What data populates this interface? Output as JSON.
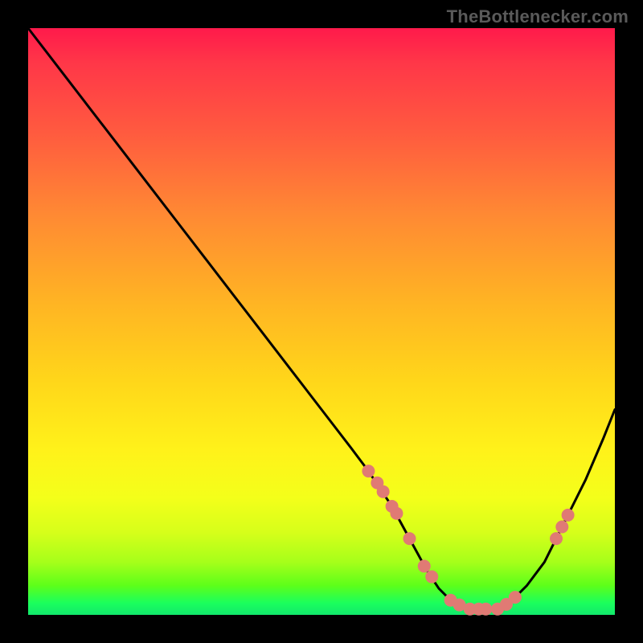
{
  "watermark": "TheBottlenecker.com",
  "colors": {
    "background": "#000000",
    "watermark_text": "#5a5a5a",
    "curve_stroke": "#000000",
    "marker_fill": "#e07a74"
  },
  "chart_data": {
    "type": "line",
    "title": "",
    "xlabel": "",
    "ylabel": "",
    "xlim": [
      0,
      100
    ],
    "ylim": [
      0,
      100
    ],
    "x": [
      0,
      5,
      10,
      15,
      20,
      25,
      30,
      35,
      40,
      45,
      50,
      55,
      58,
      60,
      62,
      65,
      68,
      70,
      72,
      75,
      78,
      80,
      83,
      85,
      88,
      90,
      92,
      95,
      98,
      100
    ],
    "values": [
      100,
      93.5,
      87,
      80.5,
      74,
      67.5,
      61,
      54.5,
      48,
      41.5,
      35,
      28.5,
      24.5,
      21.5,
      18.5,
      13,
      7.5,
      4.5,
      2.5,
      1,
      1,
      1,
      3,
      5,
      9,
      13,
      17,
      23,
      30,
      35
    ],
    "markers": {
      "x": [
        58,
        59.5,
        60.5,
        62,
        62.8,
        65,
        67.5,
        68.8,
        72,
        73.5,
        75.3,
        76.8,
        78,
        80,
        81.5,
        83,
        90,
        91,
        92
      ],
      "values": [
        24.5,
        22.5,
        21,
        18.5,
        17.3,
        13.0,
        8.3,
        6.5,
        2.5,
        1.7,
        1.0,
        1.0,
        1.0,
        1.0,
        1.8,
        3.0,
        13.0,
        15.0,
        17.0
      ]
    }
  }
}
